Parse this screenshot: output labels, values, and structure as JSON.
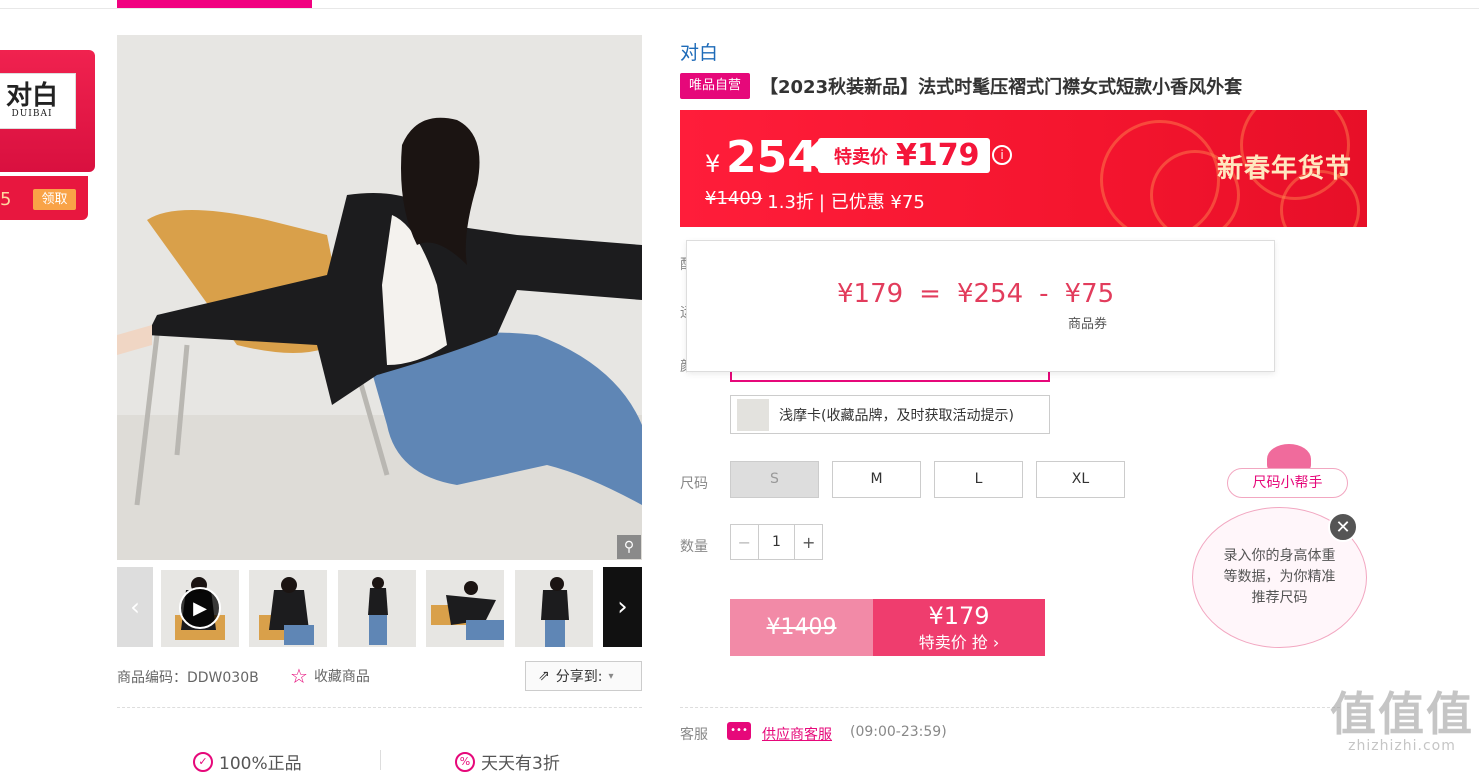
{
  "brand_coupon": {
    "logo_big": "对白",
    "logo_small": "DUIBAI",
    "amount_partial": "5",
    "claim_label": "领取"
  },
  "gallery": {
    "prev_label": "‹",
    "next_label": "›",
    "zoom_icon": "magnifier-icon",
    "play_icon": "▶"
  },
  "product_meta": {
    "sku_label": "商品编码：DDW030B",
    "favorite_label": "收藏商品",
    "share_label": "分享到:",
    "features": [
      "100%正品",
      "天天有3折"
    ]
  },
  "product": {
    "brand": "对白",
    "self_tag": "唯品自营",
    "title": "【2023秋装新品】法式时髦压褶式门襟女式短款小香风外套"
  },
  "price": {
    "yen": "¥",
    "current": "254",
    "sale_label": "特卖价",
    "sale_price": "¥179",
    "original": "¥1409",
    "discount": "1.3折",
    "saved": "| 已优惠 ¥75",
    "festival": "新春年货节"
  },
  "breakdown": {
    "a": "¥179",
    "eq": "=",
    "b": "¥254",
    "minus": "-",
    "c": "¥75",
    "c_label": "商品券"
  },
  "labels": {
    "row1": "配",
    "row2": "运",
    "row3": "颜",
    "size": "尺码",
    "qty": "数量",
    "service": "客服"
  },
  "color_option": "浅摩卡(收藏品牌，及时获取活动提示)",
  "sizes": [
    "S",
    "M",
    "L",
    "XL"
  ],
  "quantity": {
    "minus": "−",
    "value": "1",
    "plus": "+"
  },
  "buy": {
    "original": "¥1409",
    "price": "¥179",
    "action": "特卖价 抢 ›"
  },
  "service": {
    "link": "供应商客服",
    "hours": "(09:00-23:59)"
  },
  "size_helper": {
    "tag": "尺码小帮手",
    "text": "录入你的身高体重等数据，为你精准推荐尺码",
    "close": "✕"
  },
  "watermark": {
    "mark": "值值值",
    "site": "zhizhizhi.com"
  }
}
